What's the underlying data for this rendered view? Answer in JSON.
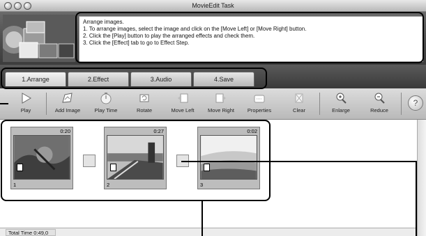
{
  "window": {
    "title": "MovieEdit Task"
  },
  "instructions": {
    "lines": [
      "Arrange images.",
      "1. To arrange images, select the image and click on the [Move Left] or [Move Right] button.",
      "2. Click the [Play] button to play the arranged effects and check them.",
      "3. Click the [Effect] tab to go to Effect Step."
    ]
  },
  "tabs": [
    {
      "label": "1.Arrange"
    },
    {
      "label": "2.Effect"
    },
    {
      "label": "3.Audio"
    },
    {
      "label": "4.Save"
    }
  ],
  "toolbar": {
    "items": [
      {
        "label": "Play",
        "icon": "play-icon"
      },
      {
        "label": "Add Image",
        "icon": "add-image-icon"
      },
      {
        "label": "Play Time",
        "icon": "stopwatch-icon"
      },
      {
        "label": "Rotate",
        "icon": "rotate-icon"
      },
      {
        "label": "Move Left",
        "icon": "move-left-icon"
      },
      {
        "label": "Move Right",
        "icon": "move-right-icon"
      },
      {
        "label": "Properties",
        "icon": "properties-icon"
      },
      {
        "label": "Clear",
        "icon": "clear-icon"
      },
      {
        "label": "Enlarge",
        "icon": "zoom-in-icon"
      },
      {
        "label": "Reduce",
        "icon": "zoom-out-icon"
      }
    ],
    "help": "?"
  },
  "clips": [
    {
      "number": "1",
      "duration": "0:20"
    },
    {
      "number": "2",
      "duration": "0:27"
    },
    {
      "number": "3",
      "duration": "0:02"
    }
  ],
  "status": {
    "total_time": "Total Time  0:49,0"
  }
}
